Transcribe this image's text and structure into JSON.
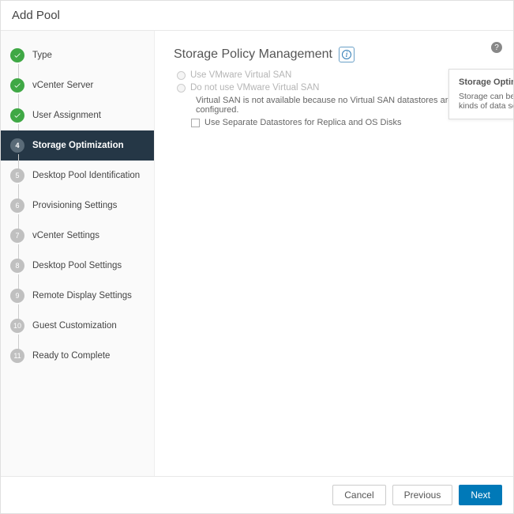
{
  "window": {
    "title": "Add Pool"
  },
  "sidebar": {
    "steps": [
      {
        "num": "",
        "label": "Type",
        "state": "done"
      },
      {
        "num": "",
        "label": "vCenter Server",
        "state": "done"
      },
      {
        "num": "",
        "label": "User Assignment",
        "state": "done"
      },
      {
        "num": "4",
        "label": "Storage Optimization",
        "state": "current"
      },
      {
        "num": "5",
        "label": "Desktop Pool Identification",
        "state": "future"
      },
      {
        "num": "6",
        "label": "Provisioning Settings",
        "state": "future"
      },
      {
        "num": "7",
        "label": "vCenter Settings",
        "state": "future"
      },
      {
        "num": "8",
        "label": "Desktop Pool Settings",
        "state": "future"
      },
      {
        "num": "9",
        "label": "Remote Display Settings",
        "state": "future"
      },
      {
        "num": "10",
        "label": "Guest Customization",
        "state": "future"
      },
      {
        "num": "11",
        "label": "Ready to Complete",
        "state": "future"
      }
    ]
  },
  "content": {
    "heading": "Storage Policy Management",
    "radio1": "Use VMware Virtual SAN",
    "radio2": "Do not use VMware Virtual SAN",
    "warning": "Virtual SAN is not available because no Virtual SAN datastores are configured.",
    "checkbox1": "Use Separate Datastores for Replica and OS Disks"
  },
  "tooltip": {
    "title": "Storage Optimization",
    "body": "Storage can be optimized by storing different kinds of data separately."
  },
  "footer": {
    "cancel": "Cancel",
    "previous": "Previous",
    "next": "Next"
  }
}
